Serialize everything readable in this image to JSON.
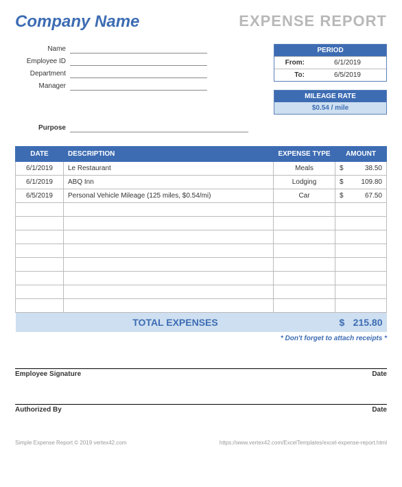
{
  "header": {
    "company": "Company Name",
    "title": "EXPENSE REPORT"
  },
  "fields": {
    "name_label": "Name",
    "employee_id_label": "Employee ID",
    "department_label": "Department",
    "manager_label": "Manager",
    "purpose_label": "Purpose"
  },
  "period": {
    "header": "PERIOD",
    "from_label": "From:",
    "from_value": "6/1/2019",
    "to_label": "To:",
    "to_value": "6/5/2019"
  },
  "mileage": {
    "header": "MILEAGE RATE",
    "value": "$0.54 / mile"
  },
  "table": {
    "headers": {
      "date": "DATE",
      "description": "DESCRIPTION",
      "expense_type": "EXPENSE TYPE",
      "amount": "AMOUNT"
    },
    "rows": [
      {
        "date": "6/1/2019",
        "description": "Le Restaurant",
        "type": "Meals",
        "currency": "$",
        "amount": "38.50"
      },
      {
        "date": "6/1/2019",
        "description": "ABQ Inn",
        "type": "Lodging",
        "currency": "$",
        "amount": "109.80"
      },
      {
        "date": "6/5/2019",
        "description": "Personal Vehicle Mileage (125 miles, $0.54/mi)",
        "type": "Car",
        "currency": "$",
        "amount": "67.50"
      }
    ],
    "total_label": "TOTAL EXPENSES",
    "total_currency": "$",
    "total_amount": "215.80"
  },
  "reminder": "* Don't forget to attach receipts *",
  "signatures": {
    "employee": "Employee Signature",
    "authorized": "Authorized By",
    "date": "Date"
  },
  "footer": {
    "left": "Simple Expense Report © 2019 vertex42.com",
    "right": "https://www.vertex42.com/ExcelTemplates/excel-expense-report.html"
  }
}
